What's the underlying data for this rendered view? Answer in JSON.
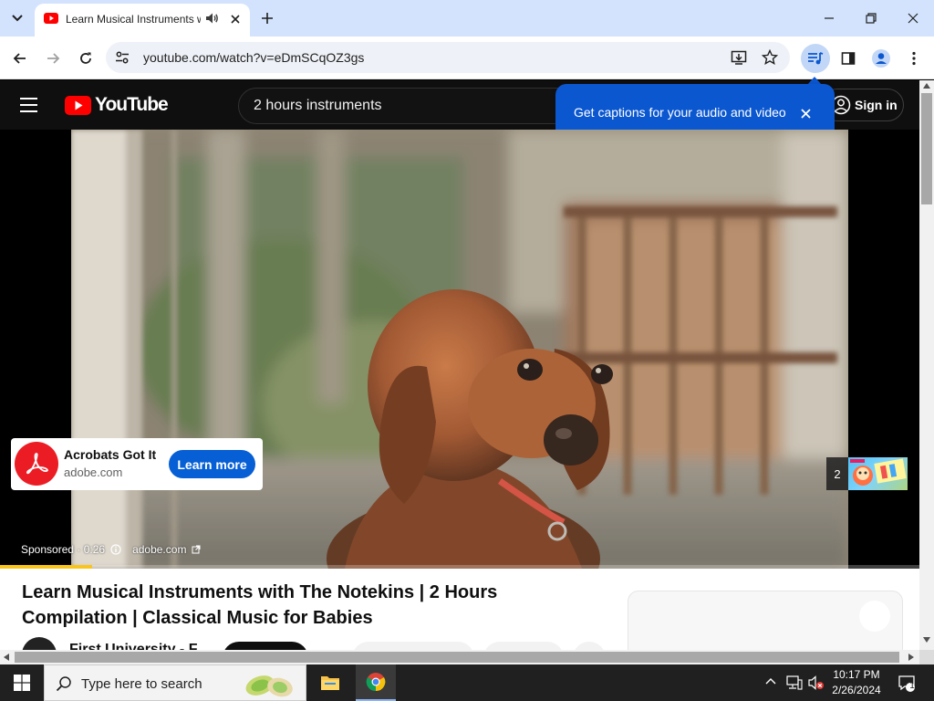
{
  "browser": {
    "tab": {
      "title": "Learn Musical Instruments w"
    },
    "omnibox": {
      "url": "youtube.com/watch?v=eDmSCqOZ3gs"
    }
  },
  "youtube": {
    "logo_text": "YouTube",
    "search_query": "2 hours instruments",
    "sign_in_label": "Sign in",
    "captions_bubble": "Get captions for your audio and video"
  },
  "ad": {
    "title": "Acrobats Got It",
    "domain": "adobe.com",
    "cta": "Learn more",
    "sponsored": "Sponsored · 0:26",
    "link_domain": "adobe.com",
    "ad_count": "2",
    "progress": 0.1
  },
  "video": {
    "title": "Learn Musical Instruments with The Notekins | 2 Hours Compilation | Classical Music for Babies",
    "channel": "First University - F"
  },
  "taskbar": {
    "search_placeholder": "Type here to search",
    "time": "10:17 PM",
    "date": "2/26/2024",
    "notification_count": "1"
  },
  "colors": {
    "youtube_red": "#ff0000",
    "chrome_tab_strip": "#d3e3fd",
    "captions_bubble": "#0b57d0",
    "learn_more": "#065fd4",
    "ad_progress": "#f9c51b",
    "acrobat_red": "#ec1c24"
  }
}
